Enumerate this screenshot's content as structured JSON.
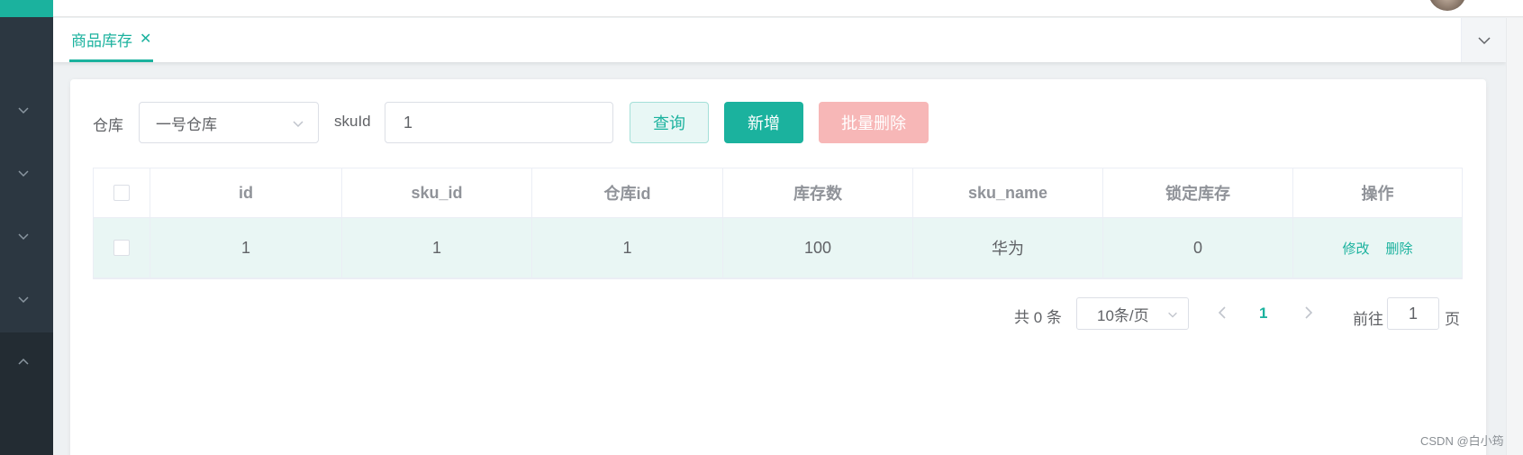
{
  "header": {
    "avatar": "user-avatar"
  },
  "tabs": [
    {
      "label": "商品库存",
      "active": true
    }
  ],
  "colors": {
    "primary": "#1bb29e",
    "danger_light": "#f7b7b7",
    "sidebar": "#2b363f"
  },
  "filters": {
    "warehouse_label": "仓库",
    "warehouse_value": "一号仓库",
    "skuid_label": "skuId",
    "skuid_value": "1"
  },
  "buttons": {
    "query": "查询",
    "add": "新增",
    "batch_delete": "批量删除"
  },
  "table": {
    "columns": [
      "id",
      "sku_id",
      "仓库id",
      "库存数",
      "sku_name",
      "锁定库存",
      "操作"
    ],
    "rows": [
      {
        "id": "1",
        "sku_id": "1",
        "warehouse_id": "1",
        "stock": "100",
        "sku_name": "华为",
        "locked": "0"
      }
    ],
    "row_actions": {
      "edit": "修改",
      "delete": "删除"
    }
  },
  "pagination": {
    "total": "共 0 条",
    "page_size": "10条/页",
    "current_page": "1",
    "jump_label": "前往",
    "jump_value": "1",
    "jump_suffix": "页"
  },
  "watermark": "CSDN @白小筠"
}
